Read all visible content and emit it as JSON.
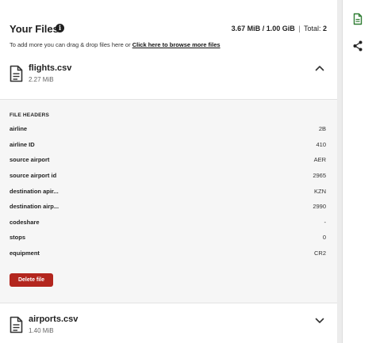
{
  "header": {
    "title": "Your Files",
    "usage_used": "3.67 MiB",
    "usage_sep1": "/",
    "usage_limit": "1.00 GiB",
    "usage_pipe": "|",
    "usage_total_label": "Total:",
    "usage_total_count": "2",
    "hint_text": "To add more you can drag & drop files here or",
    "hint_link": "Click here to browse more files"
  },
  "files": [
    {
      "name": "flights.csv",
      "size": "2.27 MiB",
      "expanded": true
    },
    {
      "name": "airports.csv",
      "size": "1.40 MiB",
      "expanded": false
    }
  ],
  "details": {
    "heading": "FILE HEADERS",
    "rows": [
      {
        "key": "airline",
        "value": "2B"
      },
      {
        "key": "airline ID",
        "value": "410"
      },
      {
        "key": "source airport",
        "value": "AER"
      },
      {
        "key": "source airport id",
        "value": "2965"
      },
      {
        "key": "destination apir...",
        "value": "KZN"
      },
      {
        "key": "destination airp...",
        "value": "2990"
      },
      {
        "key": "codeshare",
        "value": "-"
      },
      {
        "key": "stops",
        "value": "0"
      },
      {
        "key": "equipment",
        "value": "CR2"
      }
    ],
    "delete_label": "Delete file"
  },
  "rail": {
    "icons": [
      "file-document-icon",
      "share-icon"
    ],
    "accent_color": "#2e7d32"
  },
  "colors": {
    "danger": "#b3261e"
  }
}
